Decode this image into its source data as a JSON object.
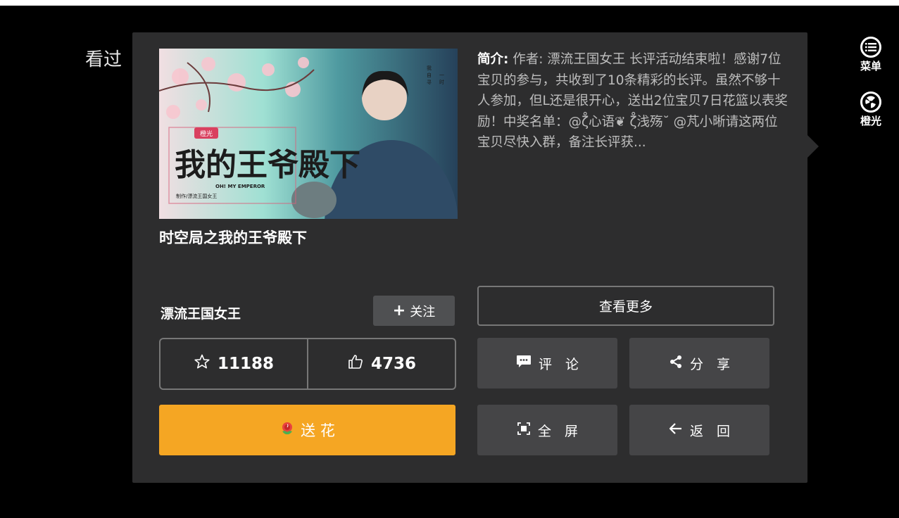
{
  "background": {
    "heading": "看过"
  },
  "side_tools": [
    {
      "label": "菜单",
      "icon": "menu-list-icon"
    },
    {
      "label": "橙光",
      "icon": "orange-light-logo-icon"
    }
  ],
  "book": {
    "title": "时空局之我的王爷殿下",
    "cover_title": "我的王爷殿下",
    "cover_subtitle": "OH! MY EMPEROR",
    "cover_tag": "橙光",
    "cover_credit": "制作/漂流王国女王"
  },
  "summary": {
    "label": "简介:",
    "text": " 作者: 漂流王国女王 长评活动结束啦！感谢7位宝贝的参与，共收到了10条精彩的长评。虽然不够十人参加，但L还是很开心，送出2位宝贝7日花篮以表奖励！中奖名单：@ζ̊心语❦ ζ̊浅殇˘ @芃小晰请这两位宝贝尽快入群，备注长评获..."
  },
  "author": {
    "name": "漂流王国女王",
    "follow_label": "关注"
  },
  "stats": {
    "favorites": "11188",
    "likes": "4736"
  },
  "buttons": {
    "send_flower": "送 花",
    "view_more": "查看更多",
    "comment": "评　论",
    "share": "分　享",
    "fullscreen": "全　屏",
    "back": "返　回"
  },
  "colors": {
    "panel": "#2d2d2e",
    "accent": "#f5a623",
    "button": "#454547"
  }
}
